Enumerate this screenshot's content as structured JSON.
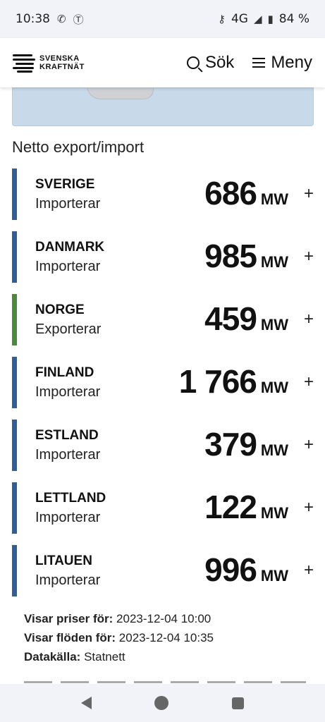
{
  "status_bar": {
    "time": "10:38",
    "network": "4G",
    "battery": "84 %",
    "icons": [
      "whatsapp-icon",
      "tiktok-like-icon",
      "key-icon",
      "signal-icon",
      "battery-icon"
    ]
  },
  "header": {
    "logo_line1": "SVENSKA",
    "logo_line2": "KRAFTNÄT",
    "search_label": "Sök",
    "menu_label": "Meny"
  },
  "section": {
    "title": "Netto export/import"
  },
  "colors": {
    "import": "#2f5f99",
    "export": "#4a8a3a"
  },
  "flows": [
    {
      "country": "SVERIGE",
      "status": "Importerar",
      "value": "686",
      "unit": "MW",
      "direction": "import"
    },
    {
      "country": "DANMARK",
      "status": "Importerar",
      "value": "985",
      "unit": "MW",
      "direction": "import"
    },
    {
      "country": "NORGE",
      "status": "Exporterar",
      "value": "459",
      "unit": "MW",
      "direction": "export"
    },
    {
      "country": "FINLAND",
      "status": "Importerar",
      "value": "1 766",
      "unit": "MW",
      "direction": "import"
    },
    {
      "country": "ESTLAND",
      "status": "Importerar",
      "value": "379",
      "unit": "MW",
      "direction": "import"
    },
    {
      "country": "LETTLAND",
      "status": "Importerar",
      "value": "122",
      "unit": "MW",
      "direction": "import"
    },
    {
      "country": "LITAUEN",
      "status": "Importerar",
      "value": "996",
      "unit": "MW",
      "direction": "import"
    }
  ],
  "meta": {
    "prices_label": "Visar priser för:",
    "prices_value": "2023-12-04 10:00",
    "flows_label": "Visar flöden för:",
    "flows_value": "2023-12-04 10:35",
    "source_label": "Datakälla:",
    "source_value": "Statnett"
  }
}
